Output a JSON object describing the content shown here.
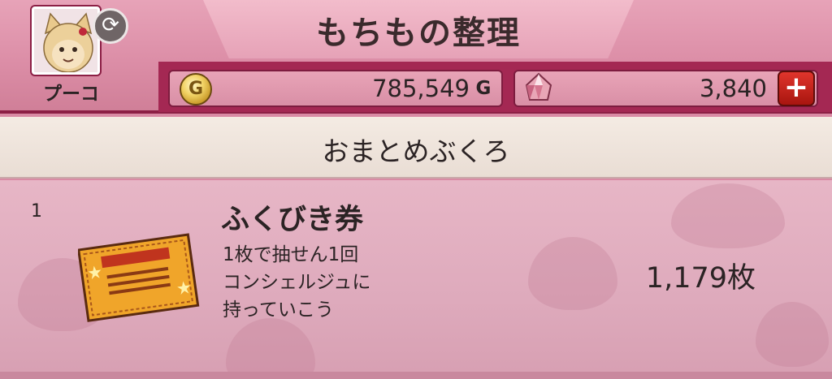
{
  "header": {
    "title": "もちもの整理",
    "character_name": "プーコ",
    "gold": {
      "value": "785,549",
      "unit": "G",
      "icon": "gold-coin-icon"
    },
    "gems": {
      "value": "3,840",
      "icon": "gem-icon"
    },
    "add_button_label": "+"
  },
  "category": {
    "title": "おまとめぶくろ"
  },
  "items": [
    {
      "index": "1",
      "name": "ふくびき券",
      "description": [
        "1枚で抽せん1回",
        "コンシェルジュに",
        "持っていこう"
      ],
      "count": "1,179枚",
      "icon": "lottery-ticket-icon"
    }
  ],
  "colors": {
    "accent": "#a42853",
    "header_bg": "#dc8ea7",
    "list_bg": "#e7b6c6",
    "plus_button": "#c8221a",
    "ticket": "#f0a52a"
  }
}
